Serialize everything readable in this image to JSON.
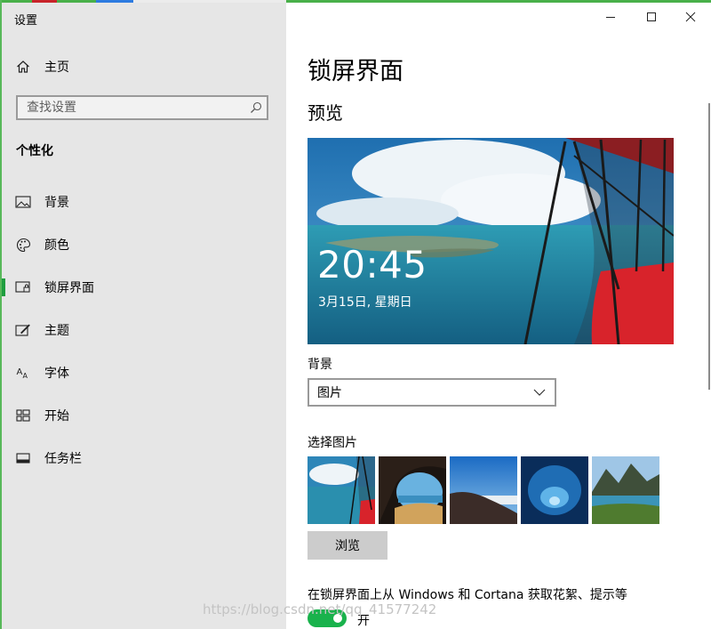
{
  "window": {
    "title": "设置",
    "controls": {
      "minimize": "minimize-icon",
      "maximize": "maximize-icon",
      "close": "close-icon"
    }
  },
  "sidebar": {
    "home_label": "主页",
    "search_placeholder": "查找设置",
    "section_title": "个性化",
    "items": [
      {
        "label": "背景",
        "icon": "picture-icon"
      },
      {
        "label": "颜色",
        "icon": "palette-icon"
      },
      {
        "label": "锁屏界面",
        "icon": "lock-screen-icon",
        "selected": true
      },
      {
        "label": "主题",
        "icon": "theme-icon"
      },
      {
        "label": "字体",
        "icon": "font-icon"
      },
      {
        "label": "开始",
        "icon": "start-icon"
      },
      {
        "label": "任务栏",
        "icon": "taskbar-icon"
      }
    ]
  },
  "main": {
    "title": "锁屏界面",
    "preview_heading": "预览",
    "preview": {
      "time": "20:45",
      "date": "3月15日, 星期日"
    },
    "background_label": "背景",
    "background_value": "图片",
    "choose_picture_label": "选择图片",
    "thumbnails": [
      "thumbnail-airplane-wing",
      "thumbnail-cave-beach",
      "thumbnail-volcano-sky",
      "thumbnail-ice-cave",
      "thumbnail-mountain-lake"
    ],
    "browse_label": "浏览",
    "fun_facts_text": "在锁屏界面上从 Windows 和 Cortana 获取花絮、提示等",
    "toggle_state": "开",
    "toggle_on": true
  },
  "colors": {
    "accent": "#19b24c",
    "sidebar_bg": "#e6e6e6"
  },
  "watermark": "https://blog.csdn.net/qq_41577242"
}
